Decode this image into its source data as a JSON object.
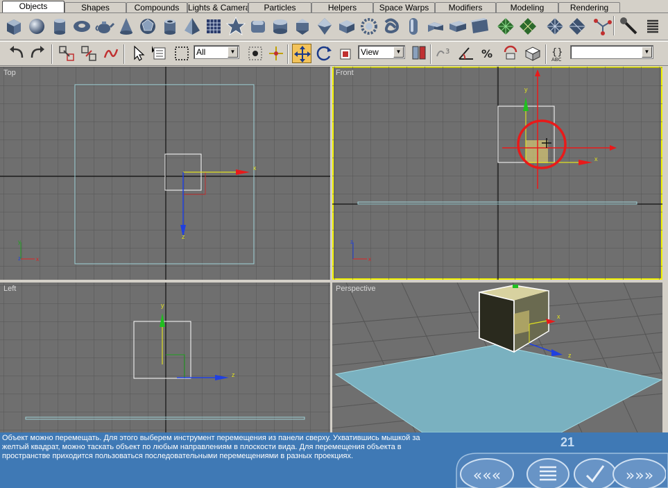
{
  "tabs": [
    {
      "label": "Objects",
      "active": true
    },
    {
      "label": "Shapes"
    },
    {
      "label": "Compounds"
    },
    {
      "label": "Lights & Cameras"
    },
    {
      "label": "Particles"
    },
    {
      "label": "Helpers"
    },
    {
      "label": "Space Warps"
    },
    {
      "label": "Modifiers"
    },
    {
      "label": "Modeling"
    },
    {
      "label": "Rendering"
    }
  ],
  "create_icons": [
    "box-icon",
    "sphere-icon",
    "cylinder-icon",
    "torus-icon",
    "teapot-icon",
    "cone-icon",
    "geosphere-icon",
    "tube-icon",
    "pyramid-icon",
    "plane-icon",
    "hedra-icon",
    "chamfer-box-icon",
    "oil-tank-icon",
    "spindle-icon",
    "gengon-icon",
    "gear-icon",
    "torus-knot-icon",
    "capsule-icon",
    "l-ext-icon",
    "c-ext-icon",
    "prism-icon",
    "grid-green-icon",
    "grid-mesh-icon",
    "hose-icon",
    "spring-icon"
  ],
  "toolbar": {
    "selection_filter": "All",
    "reference_coord": "View",
    "named_selection": ""
  },
  "viewports": {
    "top": "Top",
    "front": "Front",
    "left": "Left",
    "perspective": "Perspective"
  },
  "axis_labels": {
    "x": "x",
    "y": "y",
    "z": "z"
  },
  "instructions": "Объект можно перемещать. Для этого выберем инструмент перемещения из панели сверху. Ухватившись мышкой за желтый квадрат, можно таскать объект по любым направлениям в плоскости вида. Для перемещения объекта в пространстве приходится пользоваться последовательными перемещениями в разных проекциях.",
  "page_number": "21",
  "nav": [
    "first-icon",
    "contents-icon",
    "check-icon",
    "next-icon"
  ],
  "colors": {
    "viewport_bg": "#6f6f6f",
    "grid": "#555555",
    "active_border": "#f4f400",
    "bottom_bar": "#3f79b5",
    "ground_plane": "#7ab1c0"
  }
}
